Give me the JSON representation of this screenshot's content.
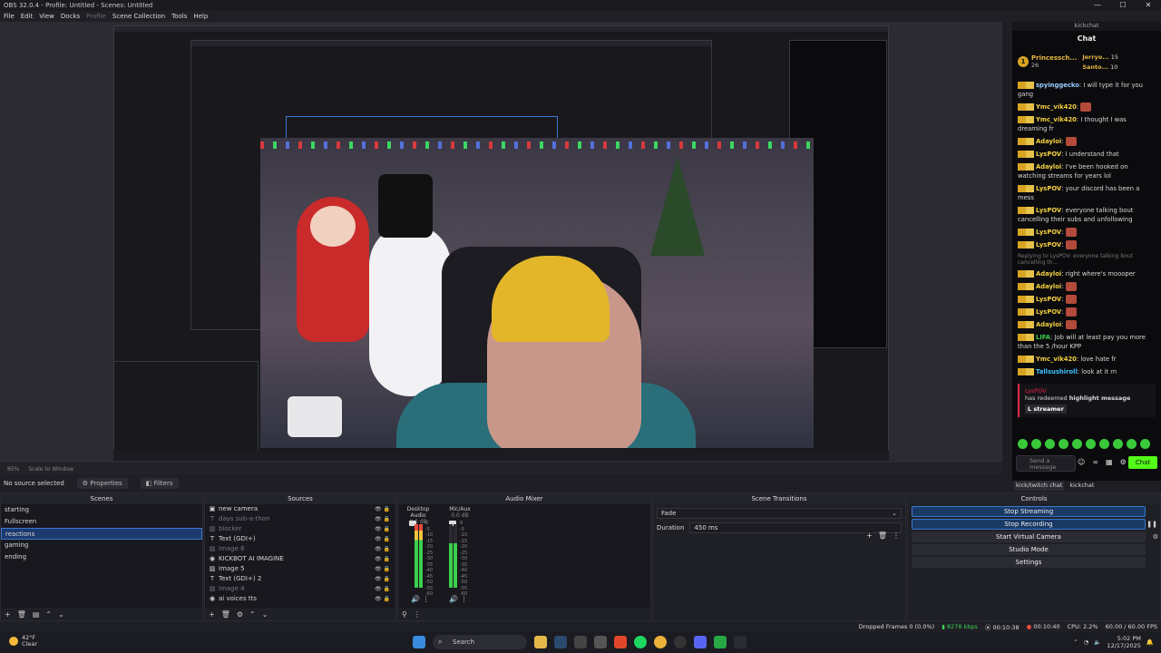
{
  "window": {
    "title": "OBS 32.0.4 - Profile: Untitled - Scenes: Untitled",
    "minimize": "—",
    "maximize": "☐",
    "close": "✕"
  },
  "menu": {
    "file": "File",
    "edit": "Edit",
    "view": "View",
    "docks": "Docks",
    "profile": "Profile",
    "scene_collection": "Scene Collection",
    "tools": "Tools",
    "help": "Help"
  },
  "preview": {
    "zoom": "85%",
    "scale_mode": "Scale to Window"
  },
  "chat": {
    "dock_title": "kickchat",
    "header": "Chat",
    "leaderboard": {
      "top": {
        "name": "Princessch...",
        "score": "26"
      },
      "second": {
        "name": "Jerryo...",
        "score": "15"
      },
      "third": {
        "name": "Santo...",
        "score": "10"
      }
    },
    "messages": [
      {
        "user": "spyinggecko",
        "text": "I will type it for you gang",
        "color": "#9acdff"
      },
      {
        "user": "Ymc_vik420",
        "text": "",
        "color": "#f4d03f"
      },
      {
        "user": "Ymc_vik420",
        "text": "I thought I was dreaming fr",
        "color": "#f4d03f"
      },
      {
        "user": "Adayloi",
        "text": "",
        "color": "#f4d03f"
      },
      {
        "user": "LysPOV",
        "text": "I understand that",
        "color": "#f4d03f"
      },
      {
        "user": "Adayloi",
        "text": "I've been hooked on watching streams for years lol",
        "color": "#f4d03f"
      },
      {
        "user": "LysPOV",
        "text": "your discord has been a mess",
        "color": "#f4d03f"
      },
      {
        "user": "LysPOV",
        "text": "everyone talking bout cancelling their subs and unfollowing",
        "color": "#f4d03f"
      },
      {
        "user": "LysPOV",
        "text": "",
        "color": "#f4d03f"
      },
      {
        "user": "LysPOV",
        "text": "",
        "color": "#f4d03f"
      }
    ],
    "reply_note": "Replying to LysPOV: everyone talking bout cancelling th...",
    "messages2": [
      {
        "user": "Adayloi",
        "text": "right where's moooper",
        "color": "#f4d03f"
      },
      {
        "user": "Adayloi",
        "text": "",
        "color": "#f4d03f"
      },
      {
        "user": "LysPOV",
        "text": "",
        "color": "#f4d03f"
      },
      {
        "user": "LysPOV",
        "text": "",
        "color": "#f4d03f"
      },
      {
        "user": "Adayloi",
        "text": "",
        "color": "#f4d03f"
      },
      {
        "user": "LIFA",
        "text": "Job will at least pay you more than the 5 /hour KPP",
        "color": "#3ccf4e"
      },
      {
        "user": "Ymc_vik420",
        "text": "love hate fr",
        "color": "#f4d03f"
      },
      {
        "user": "Tallsushiroll",
        "text": "look at it rn",
        "color": "#3fc1ff"
      }
    ],
    "redeem": {
      "user": "LysPOV",
      "text": "has redeemed",
      "reward": "highlight message",
      "tag": "L streamer"
    },
    "input_placeholder": "Send a message",
    "send_label": "Chat",
    "tab_active": "kick/twitch chat",
    "tab_other": "kickchat"
  },
  "status_line": {
    "no_source": "No source selected",
    "properties": "Properties",
    "filters": "Filters"
  },
  "scenes": {
    "title": "Scenes",
    "items": [
      "starting",
      "Fullscreen",
      "reactions",
      "gaming",
      "ending"
    ],
    "selected": "reactions"
  },
  "sources": {
    "title": "Sources",
    "items": [
      {
        "name": "new camera",
        "icon": "camera-icon",
        "visible": true
      },
      {
        "name": "days sub-a-thon",
        "icon": "text-icon",
        "visible": false
      },
      {
        "name": "blocker",
        "icon": "image-icon",
        "visible": false
      },
      {
        "name": "Text (GDI+)",
        "icon": "text-icon",
        "visible": true
      },
      {
        "name": "Image 6",
        "icon": "image-icon",
        "visible": false
      },
      {
        "name": "KICKBOT AI IMAGINE",
        "icon": "browser-icon",
        "visible": true
      },
      {
        "name": "Image 5",
        "icon": "image-icon",
        "visible": true
      },
      {
        "name": "Text (GDI+) 2",
        "icon": "text-icon",
        "visible": true
      },
      {
        "name": "Image 4",
        "icon": "image-icon",
        "visible": false
      },
      {
        "name": "ai voices tts",
        "icon": "browser-icon",
        "visible": true
      }
    ]
  },
  "mixer": {
    "title": "Audio Mixer",
    "channels": [
      {
        "name": "Desktop Audio",
        "db": "0.0 dB"
      },
      {
        "name": "Mic/Aux",
        "db": "0.0 dB"
      }
    ],
    "ticks": [
      "0",
      "-5",
      "-10",
      "-15",
      "-20",
      "-25",
      "-30",
      "-35",
      "-40",
      "-45",
      "-50",
      "-55",
      "-60"
    ]
  },
  "transitions": {
    "title": "Scene Transitions",
    "selected": "Fade",
    "duration_label": "Duration",
    "duration_value": "450 ms"
  },
  "controls": {
    "title": "Controls",
    "stop_streaming": "Stop Streaming",
    "stop_recording": "Stop Recording",
    "virtual_camera": "Start Virtual Camera",
    "studio_mode": "Studio Mode",
    "settings": "Settings"
  },
  "obs_status": {
    "dropped": "Dropped Frames 0 (0.0%)",
    "bitrate": "8278 kbps",
    "stream_time": "00:10:38",
    "rec_time": "00:10:40",
    "cpu": "CPU: 2.2%",
    "fps": "60.00 / 60.00 FPS"
  },
  "taskbar": {
    "temp": "42°F",
    "condition": "Clear",
    "search": "Search",
    "time": "5:02 PM",
    "date": "12/17/2025"
  },
  "colors": {
    "accent": "#3a78d0",
    "kick_green": "#53fc18",
    "gold": "#d8a422"
  }
}
